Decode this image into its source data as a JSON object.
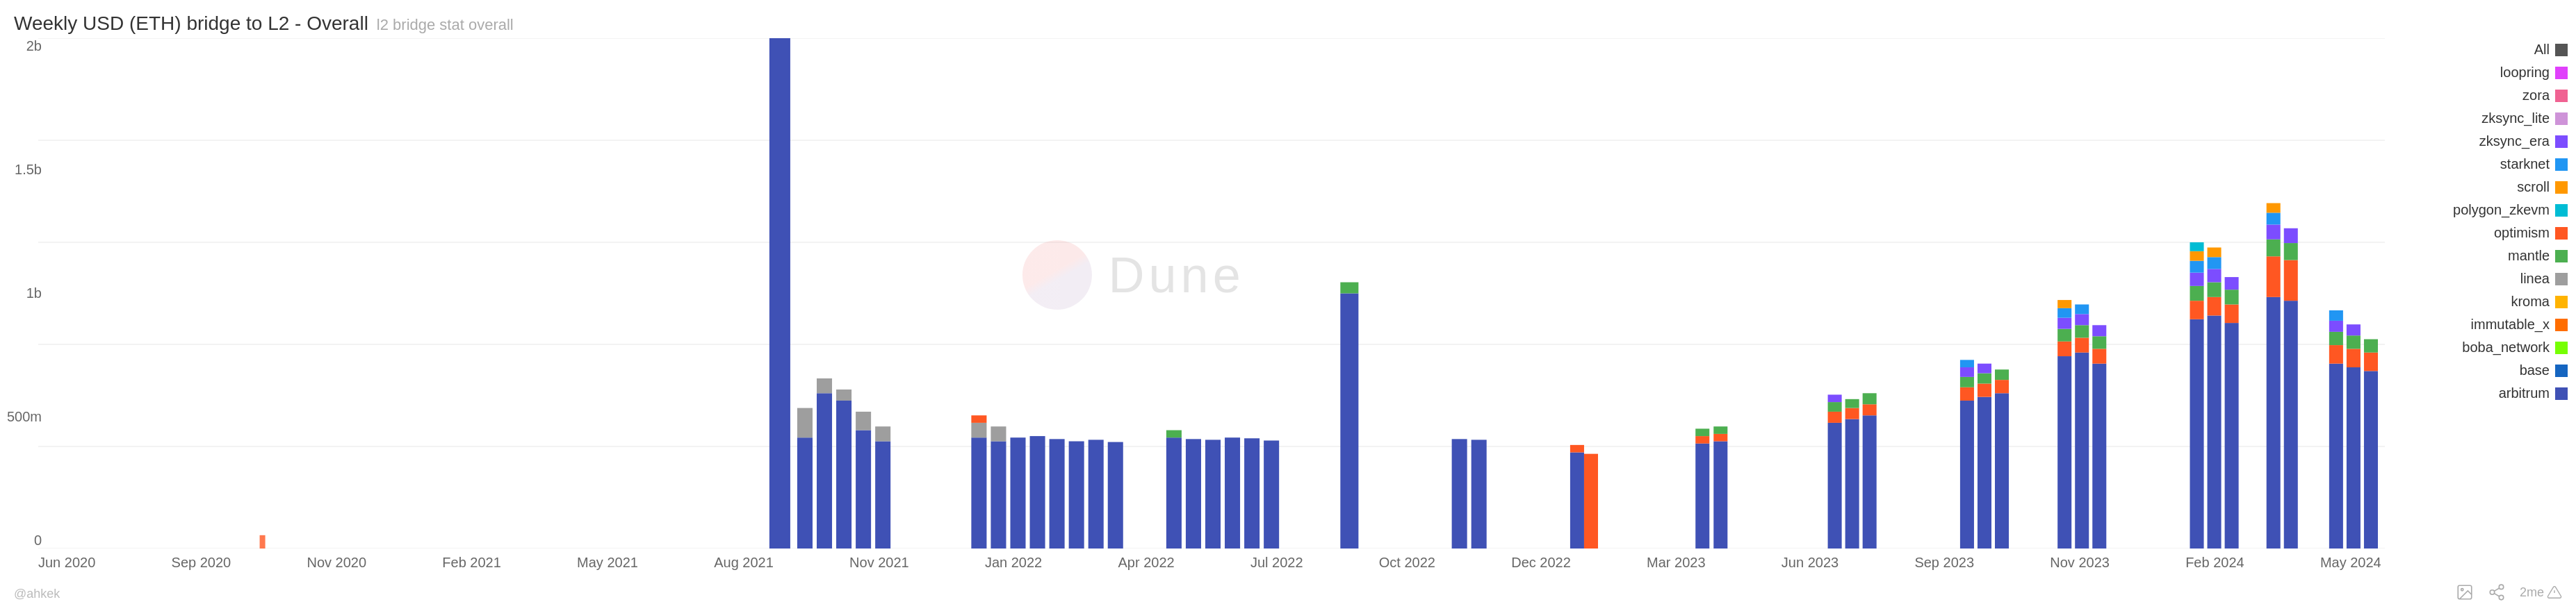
{
  "title": {
    "main": "Weekly USD (ETH) bridge to L2 - Overall",
    "sub": "l2 bridge stat overall"
  },
  "yAxis": {
    "labels": [
      "2b",
      "1.5b",
      "1b",
      "500m",
      "0"
    ]
  },
  "xAxis": {
    "labels": [
      "Jun 2020",
      "Sep 2020",
      "Nov 2020",
      "Feb 2021",
      "May 2021",
      "Aug 2021",
      "Nov 2021",
      "Jan 2022",
      "Apr 2022",
      "Jul 2022",
      "Oct 2022",
      "Dec 2022",
      "Mar 2023",
      "Jun 2023",
      "Sep 2023",
      "Nov 2023",
      "Feb 2024",
      "May 2024"
    ]
  },
  "legend": {
    "items": [
      {
        "label": "All",
        "color": "#555555"
      },
      {
        "label": "loopring",
        "color": "#e040fb"
      },
      {
        "label": "zora",
        "color": "#f06292"
      },
      {
        "label": "zksync_lite",
        "color": "#ce93d8"
      },
      {
        "label": "zksync_era",
        "color": "#7c4dff"
      },
      {
        "label": "starknet",
        "color": "#2196f3"
      },
      {
        "label": "scroll",
        "color": "#ff9800"
      },
      {
        "label": "polygon_zkevm",
        "color": "#00bcd4"
      },
      {
        "label": "optimism",
        "color": "#ff5722"
      },
      {
        "label": "mantle",
        "color": "#4caf50"
      },
      {
        "label": "linea",
        "color": "#9e9e9e"
      },
      {
        "label": "kroma",
        "color": "#ffb300"
      },
      {
        "label": "immutable_x",
        "color": "#ff6d00"
      },
      {
        "label": "boba_network",
        "color": "#76ff03"
      },
      {
        "label": "base",
        "color": "#1565c0"
      },
      {
        "label": "arbitrum",
        "color": "#3f51b5"
      }
    ]
  },
  "watermark": {
    "text": "Dune"
  },
  "footer": {
    "handle": "@ahkek",
    "icons": [
      "image-icon",
      "share-icon",
      "alert-icon"
    ]
  }
}
